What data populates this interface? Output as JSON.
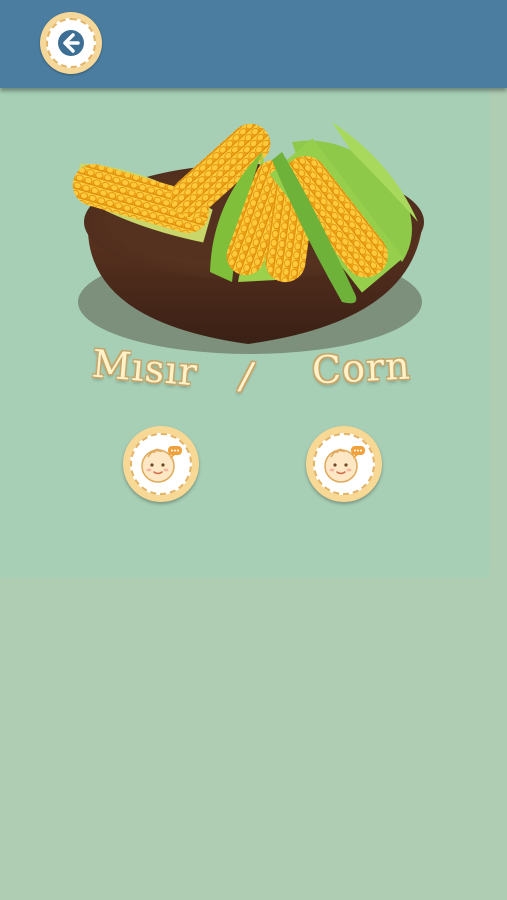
{
  "header": {
    "back_icon": "arrow-left-icon",
    "colors": {
      "bar": "#4a7da0",
      "button_ring": "#f6d79a"
    }
  },
  "card": {
    "image": "corn-in-wooden-bowl",
    "word_tr": "Mısır",
    "separator": "/",
    "word_en": "Corn"
  },
  "sound_buttons": [
    {
      "icon": "baby-face-speaking-icon",
      "language": "tr"
    },
    {
      "icon": "baby-face-speaking-icon",
      "language": "en"
    }
  ],
  "colors": {
    "background": "#afcdb3",
    "card": "#a7cfb5",
    "title_fill": "#fff2c8",
    "title_outline": "#c5a66b"
  }
}
